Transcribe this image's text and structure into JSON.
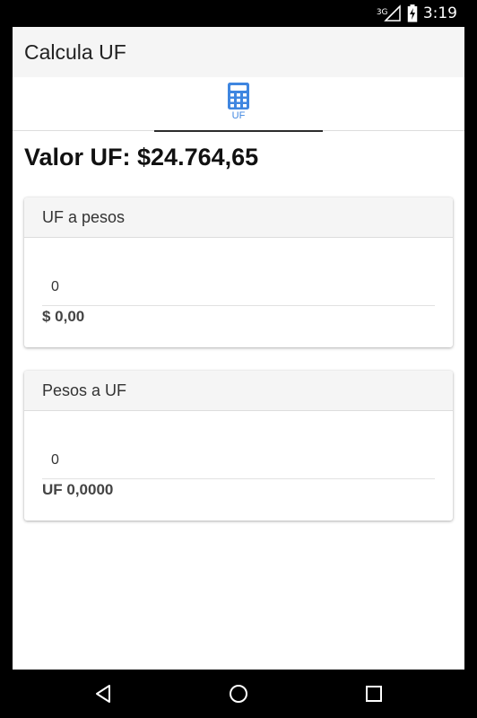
{
  "status_bar": {
    "network": "3G",
    "time": "3:19",
    "icons": [
      "signal-icon",
      "battery-charging-icon"
    ]
  },
  "app": {
    "title": "Calcula UF",
    "tab": {
      "label": "UF",
      "icon": "calculator-icon",
      "accent": "#3f86e0"
    },
    "rate_text": "Valor UF: $24.764,65"
  },
  "cards": [
    {
      "title": "UF a pesos",
      "input_value": "0",
      "result": "$ 0,00"
    },
    {
      "title": "Pesos a UF",
      "input_value": "0",
      "result": "UF 0,0000"
    }
  ],
  "navigation": {
    "icons": [
      "back-icon",
      "home-icon",
      "recents-icon"
    ]
  }
}
